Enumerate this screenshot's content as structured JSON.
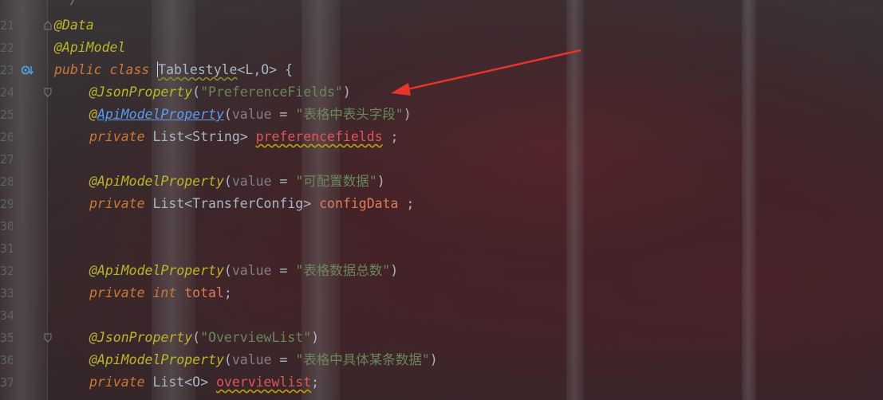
{
  "editor": {
    "line_numbers": [
      "",
      "21",
      "22",
      "23",
      "24",
      "25",
      "26",
      "27",
      "28",
      "29",
      "30",
      "31",
      "32",
      "33",
      "34",
      "35",
      "36",
      "37"
    ],
    "lines": {
      "l20": {
        "text": "*/"
      },
      "l21": {
        "annotation": "@Data"
      },
      "l22": {
        "annotation": "@ApiModel"
      },
      "l23": {
        "kw_public": "public",
        "kw_class": "class",
        "class_name": "Tablestyle",
        "generics": "<L,O> {"
      },
      "l24": {
        "annotation": "@JsonProperty",
        "open": "(",
        "string": "\"PreferenceFields\"",
        "close": ")"
      },
      "l25": {
        "at": "@",
        "annotation": "ApiModelProperty",
        "open": "(",
        "param": "value",
        "eq": " = ",
        "string": "\"表格中表头字段\"",
        "close": ")"
      },
      "l26": {
        "kw": "private",
        "type": " List<String> ",
        "field": "preferencefields",
        "end": " ;"
      },
      "l28": {
        "annotation": "@ApiModelProperty",
        "open": "(",
        "param": "value",
        "eq": " = ",
        "string": "\"可配置数据\"",
        "close": ")"
      },
      "l29": {
        "kw": "private",
        "type": " List<TransferConfig> ",
        "field": "configData",
        "end": " ;"
      },
      "l32": {
        "annotation": "@ApiModelProperty",
        "open": "(",
        "param": "value",
        "eq": " = ",
        "string": "\"表格数据总数\"",
        "close": ")"
      },
      "l33": {
        "kw": "private",
        "kw2": "int",
        "field": "total",
        "end": ";"
      },
      "l35": {
        "annotation": "@JsonProperty",
        "open": "(",
        "string": "\"OverviewList\"",
        "close": ")"
      },
      "l36": {
        "annotation": "@ApiModelProperty",
        "open": "(",
        "param": "value",
        "eq": " = ",
        "string": "\"表格中具体某条数据\"",
        "close": ")"
      },
      "l37": {
        "kw": "private",
        "type": " List<O> ",
        "field": "overviewlist",
        "end": ";"
      }
    }
  },
  "icons": {
    "gutter_implement": "override-down-arrow-icon",
    "annotation_arrow": "red-arrow-icon"
  },
  "colors": {
    "annotation": "#bbb529",
    "keyword": "#cc7832",
    "string": "#6a8759",
    "field": "#9876aa",
    "error_field": "#e05555",
    "arrow": "#e8342a"
  }
}
